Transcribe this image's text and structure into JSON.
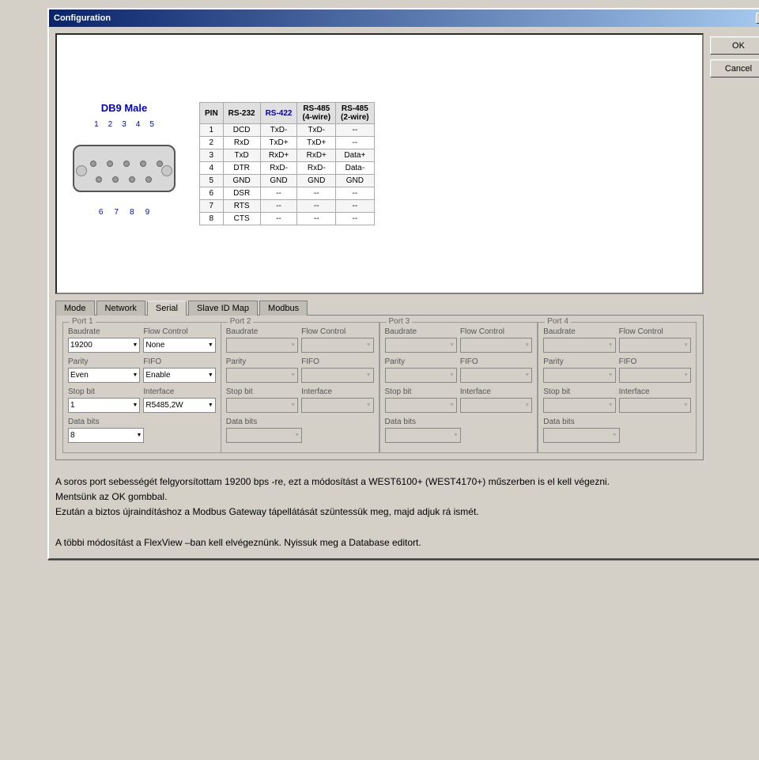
{
  "window": {
    "title": "Configuration",
    "close_label": "✕"
  },
  "buttons": {
    "ok": "OK",
    "cancel": "Cancel"
  },
  "diagram": {
    "connector_title": "DB9 Male",
    "pin_numbers_top": [
      "1",
      "2",
      "3",
      "4",
      "5"
    ],
    "pin_numbers_bottom": [
      "6",
      "7",
      "8",
      "9"
    ],
    "table": {
      "headers": [
        "PIN",
        "RS-232",
        "RS-422",
        "RS-485\n(4-wire)",
        "RS-485\n(2-wire)"
      ],
      "rows": [
        [
          "1",
          "DCD",
          "TxD-",
          "TxD-",
          "--"
        ],
        [
          "2",
          "RxD",
          "TxD+",
          "TxD+",
          "--"
        ],
        [
          "3",
          "TxD",
          "RxD+",
          "RxD+",
          "Data+"
        ],
        [
          "4",
          "DTR",
          "RxD-",
          "RxD-",
          "Data-"
        ],
        [
          "5",
          "GND",
          "GND",
          "GND",
          "GND"
        ],
        [
          "6",
          "DSR",
          "--",
          "--",
          "--"
        ],
        [
          "7",
          "RTS",
          "--",
          "--",
          "--"
        ],
        [
          "8",
          "CTS",
          "--",
          "--",
          "--"
        ]
      ]
    }
  },
  "tabs": [
    {
      "label": "Mode",
      "active": false
    },
    {
      "label": "Network",
      "active": false
    },
    {
      "label": "Serial",
      "active": true
    },
    {
      "label": "Slave ID Map",
      "active": false
    },
    {
      "label": "Modbus",
      "active": false
    }
  ],
  "ports": [
    {
      "name": "Port 1",
      "baudrate_label": "Baudrate",
      "flow_control_label": "Flow Control",
      "baudrate_value": "19200",
      "flow_control_value": "None",
      "parity_label": "Parity",
      "fifo_label": "FIFO",
      "parity_value": "Even",
      "fifo_value": "Enable",
      "stopbit_label": "Stop bit",
      "interface_label": "Interface",
      "stopbit_value": "1",
      "interface_value": "R5485,2W",
      "databits_label": "Data bits",
      "databits_value": "8",
      "enabled": true
    },
    {
      "name": "Port 2",
      "baudrate_label": "Baudrate",
      "flow_control_label": "Flow Control",
      "baudrate_value": "",
      "flow_control_value": "",
      "parity_label": "Parity",
      "fifo_label": "FIFO",
      "parity_value": "",
      "fifo_value": "",
      "stopbit_label": "Stop bit",
      "interface_label": "Interface",
      "stopbit_value": "",
      "interface_value": "",
      "databits_label": "Data bits",
      "databits_value": "",
      "enabled": false
    },
    {
      "name": "Port 3",
      "baudrate_label": "Baudrate",
      "flow_control_label": "Flow Control",
      "baudrate_value": "",
      "flow_control_value": "",
      "parity_label": "Parity",
      "fifo_label": "FIFO",
      "parity_value": "",
      "fifo_value": "",
      "stopbit_label": "Stop bit",
      "interface_label": "Interface",
      "stopbit_value": "",
      "interface_value": "",
      "databits_label": "Data bits",
      "databits_value": "",
      "enabled": false
    },
    {
      "name": "Port 4",
      "baudrate_label": "Baudrate",
      "flow_control_label": "Flow Control",
      "baudrate_value": "",
      "flow_control_value": "",
      "parity_label": "Parity",
      "fifo_label": "FIFO",
      "parity_value": "",
      "fifo_value": "",
      "stopbit_label": "Stop bit",
      "interface_label": "Interface",
      "stopbit_value": "",
      "interface_value": "",
      "databits_label": "Data bits",
      "databits_value": "",
      "enabled": false
    }
  ],
  "bottom_text": {
    "line1": "A soros port sebességét felgyorsítottam 19200 bps -re, ezt a módosítást a WEST6100+ (WEST4170+) műszerben is el kell végezni.",
    "line2": "Mentsünk az OK gombbal.",
    "line3": "Ezután a biztos újraindításhoz a Modbus Gateway tápellátását szüntessük meg, majd adjuk rá ismét.",
    "line4": "",
    "line5": "A többi módosítást a FlexView –ban kell elvégeznünk. Nyissuk meg a Database editort."
  }
}
